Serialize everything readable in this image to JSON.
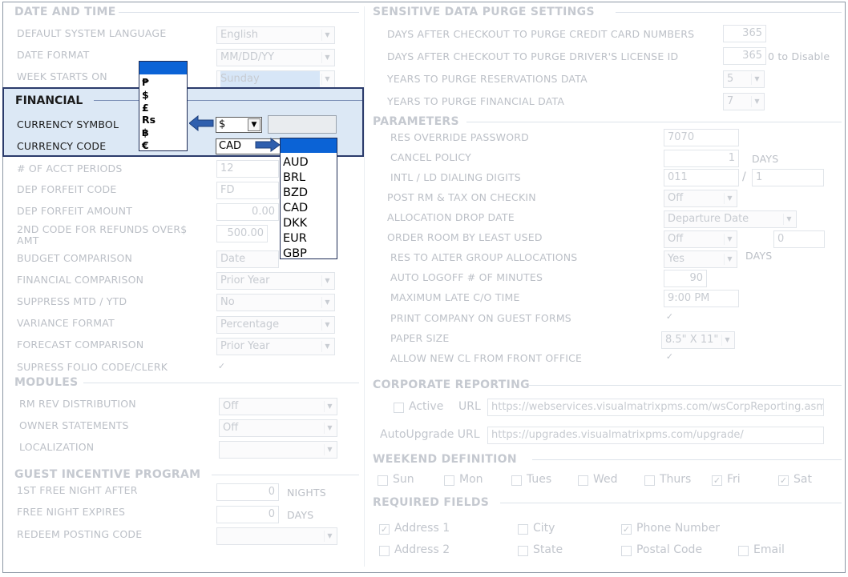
{
  "date_time": {
    "title": "DATE AND TIME",
    "default_language": {
      "label": "DEFAULT SYSTEM LANGUAGE",
      "value": "English"
    },
    "date_format": {
      "label": "DATE FORMAT",
      "value": "MM/DD/YY"
    },
    "week_starts": {
      "label": "WEEK STARTS ON",
      "value": "Sunday"
    }
  },
  "financial": {
    "title": "FINANCIAL",
    "currency_symbol": {
      "label": "CURRENCY SYMBOL",
      "value": "$"
    },
    "currency_code": {
      "label": "CURRENCY CODE",
      "value": "CAD"
    },
    "symbol_options": [
      "₱",
      "$",
      "£",
      "Rs",
      "฿",
      "€"
    ],
    "code_options": [
      "AUD",
      "BRL",
      "BZD",
      "CAD",
      "DKK",
      "EUR",
      "GBP"
    ],
    "acct_periods": {
      "label": "# OF ACCT PERIODS",
      "value": "12"
    },
    "dep_forfeit_code": {
      "label": "DEP FORFEIT CODE",
      "value": "FD"
    },
    "dep_forfeit_amount": {
      "label": "DEP FORFEIT AMOUNT",
      "value": "0.00"
    },
    "second_code_line1": "2ND CODE FOR REFUNDS OVER$",
    "second_code_line2": "AMT",
    "second_code_value": "500.00",
    "budget_comparison": {
      "label": "BUDGET COMPARISON",
      "value": "Date"
    },
    "financial_comparison": {
      "label": "FINANCIAL COMPARISON",
      "value": "Prior Year"
    },
    "suppress_mtd": {
      "label": "SUPPRESS MTD / YTD",
      "value": "No"
    },
    "variance_format": {
      "label": "VARIANCE FORMAT",
      "value": "Percentage"
    },
    "forecast_comparison": {
      "label": "FORECAST COMPARISON",
      "value": "Prior Year"
    },
    "supress_folio": {
      "label": "SUPRESS FOLIO CODE/CLERK",
      "checked": true
    }
  },
  "modules": {
    "title": "MODULES",
    "rm_rev": {
      "label": "RM REV DISTRIBUTION",
      "value": "Off"
    },
    "owner_statements": {
      "label": "OWNER STATEMENTS",
      "value": "Off"
    },
    "localization": {
      "label": "LOCALIZATION",
      "value": ""
    }
  },
  "guest_incentive": {
    "title": "GUEST INCENTIVE PROGRAM",
    "first_free": {
      "label": "1ST FREE NIGHT AFTER",
      "value": "0",
      "unit": "NIGHTS"
    },
    "free_expires": {
      "label": "FREE NIGHT EXPIRES",
      "value": "0",
      "unit": "DAYS"
    },
    "redeem_code": {
      "label": "REDEEM POSTING CODE",
      "value": ""
    }
  },
  "purge": {
    "title": "SENSITIVE DATA PURGE SETTINGS",
    "credit_card": {
      "label": "DAYS AFTER CHECKOUT TO PURGE CREDIT CARD NUMBERS",
      "value": "365"
    },
    "drivers_license": {
      "label": "DAYS AFTER CHECKOUT TO PURGE DRIVER'S LICENSE ID",
      "value": "365",
      "hint": "0 to Disable"
    },
    "reservations": {
      "label": "YEARS TO PURGE RESERVATIONS DATA",
      "value": "5"
    },
    "financial": {
      "label": "YEARS TO PURGE FINANCIAL DATA",
      "value": "7"
    }
  },
  "parameters": {
    "title": "PARAMETERS",
    "res_override": {
      "label": "RES OVERRIDE PASSWORD",
      "value": "7070"
    },
    "cancel_policy": {
      "label": "CANCEL POLICY",
      "value": "1",
      "unit": "DAYS"
    },
    "dialing": {
      "label": "INTL / LD DIALING DIGITS",
      "value1": "011",
      "sep": "/",
      "value2": "1"
    },
    "post_rm_tax": {
      "label": "POST RM & TAX ON CHECKIN",
      "value": "Off"
    },
    "allocation_drop": {
      "label": "ALLOCATION DROP DATE",
      "value": "Departure Date"
    },
    "order_room": {
      "label": "ORDER ROOM BY LEAST USED",
      "value": "Off",
      "extra": "0"
    },
    "res_alter": {
      "label": "RES TO ALTER GROUP ALLOCATIONS",
      "value": "Yes",
      "unit": "DAYS"
    },
    "auto_logoff": {
      "label": "AUTO LOGOFF # OF MINUTES",
      "value": "90"
    },
    "late_co": {
      "label": "MAXIMUM  LATE C/O TIME",
      "value": "9:00 PM"
    },
    "print_company": {
      "label": "PRINT COMPANY ON GUEST FORMS",
      "checked": true
    },
    "paper_size": {
      "label": "PAPER SIZE",
      "value": "8.5\" X 11\""
    },
    "allow_new_cl": {
      "label": "ALLOW NEW CL FROM FRONT OFFICE",
      "checked": true
    }
  },
  "corporate": {
    "title": "CORPORATE REPORTING",
    "active_label": "Active",
    "url_label": "URL",
    "url_value": "https://webservices.visualmatrixpms.com/wsCorpReporting.asmx",
    "autoupgrade_label": "AutoUpgrade URL",
    "autoupgrade_value": "https://upgrades.visualmatrixpms.com/upgrade/"
  },
  "weekend": {
    "title": "WEEKEND DEFINITION",
    "days": [
      {
        "label": "Sun",
        "checked": false
      },
      {
        "label": "Mon",
        "checked": false
      },
      {
        "label": "Tues",
        "checked": false
      },
      {
        "label": "Wed",
        "checked": false
      },
      {
        "label": "Thurs",
        "checked": false
      },
      {
        "label": "Fri",
        "checked": true
      },
      {
        "label": "Sat",
        "checked": true
      }
    ]
  },
  "required": {
    "title": "REQUIRED FIELDS",
    "fields": [
      {
        "label": "Address 1",
        "checked": true
      },
      {
        "label": "City",
        "checked": false
      },
      {
        "label": "Phone Number",
        "checked": true
      },
      {
        "label": "Address 2",
        "checked": false
      },
      {
        "label": "State",
        "checked": false
      },
      {
        "label": "Postal Code",
        "checked": false
      },
      {
        "label": "Email",
        "checked": false
      }
    ]
  },
  "colors": {
    "highlight_bg": "#dce8f5",
    "highlight_border": "#2b3b6b",
    "popup_header": "#0b63d6",
    "arrow": "#2f5fae"
  }
}
